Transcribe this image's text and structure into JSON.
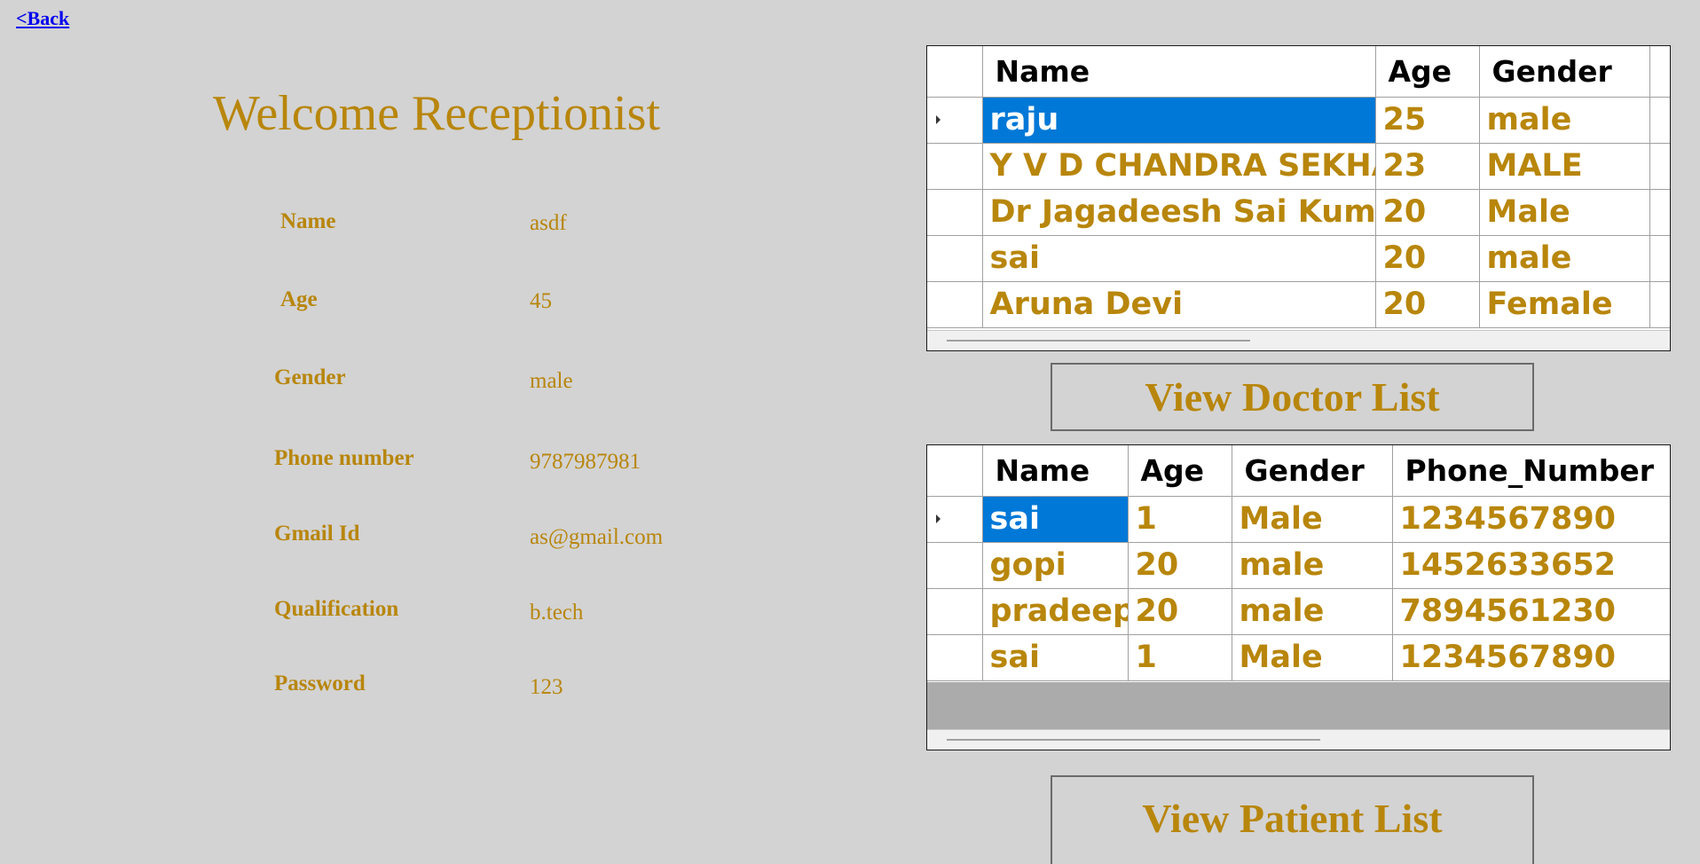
{
  "back_link": "<Back",
  "welcome_title": "Welcome Receptionist",
  "profile": {
    "fields": [
      {
        "label": "Name",
        "value": "asdf"
      },
      {
        "label": "Age",
        "value": "45"
      },
      {
        "label": "Gender",
        "value": "male"
      },
      {
        "label": "Phone number",
        "value": "9787987981"
      },
      {
        "label": "Gmail Id",
        "value": "as@gmail.com"
      },
      {
        "label": "Qualification",
        "value": "b.tech"
      },
      {
        "label": "Password",
        "value": "123"
      }
    ]
  },
  "doctor_grid": {
    "columns": [
      "Name",
      "Age",
      "Gender"
    ],
    "rows": [
      [
        "raju",
        "25",
        "male"
      ],
      [
        "Y V D CHANDRA SEKHAR",
        "23",
        "MALE"
      ],
      [
        "Dr Jagadeesh Sai Kumar",
        "20",
        "Male"
      ],
      [
        "sai",
        "20",
        "male"
      ],
      [
        "Aruna Devi",
        "20",
        "Female"
      ]
    ]
  },
  "patient_grid": {
    "columns": [
      "Name",
      "Age",
      "Gender",
      "Phone_Number"
    ],
    "rows": [
      [
        "sai",
        "1",
        "Male",
        "1234567890"
      ],
      [
        "gopi",
        "20",
        "male",
        "1452633652"
      ],
      [
        "pradeep",
        "20",
        "male",
        "7894561230"
      ],
      [
        "sai",
        "1",
        "Male",
        "1234567890"
      ]
    ]
  },
  "buttons": {
    "view_doctor_list": "View Doctor List",
    "view_patient_list": "View Patient List"
  },
  "colors": {
    "background": "#d3d3d3",
    "text_gold": "#b8860b",
    "selection": "#0078d7",
    "link": "#0000ee"
  }
}
